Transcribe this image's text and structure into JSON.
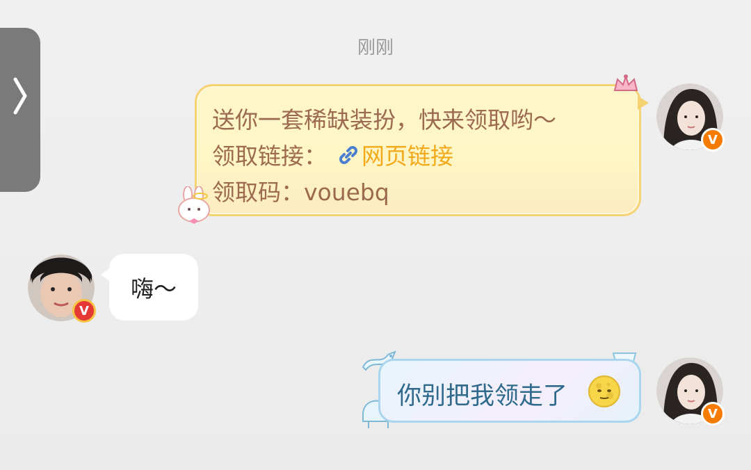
{
  "timestamp": "刚刚",
  "messages": [
    {
      "side": "right",
      "type": "card",
      "line1": "送你一套稀缺装扮，快来领取哟～",
      "line2_label": "领取链接：",
      "line2_link": "网页链接",
      "line3": "领取码：vouebq",
      "badge": "V"
    },
    {
      "side": "left",
      "type": "text",
      "text": "嗨～",
      "badge": "V"
    },
    {
      "side": "right",
      "type": "text",
      "text": "你别把我领走了",
      "emoji": "moon-face",
      "badge": "V"
    }
  ],
  "colors": {
    "card_text": "#9b6a4f",
    "link": "#f2a91a",
    "blue_text": "#2f6a8c",
    "badge_orange": "#f57c00"
  },
  "icons": [
    "chevron-right-icon",
    "link-icon",
    "moon-face-emoji",
    "bunny-sticker",
    "crown-sticker",
    "piano-sticker",
    "dragon-sticker"
  ]
}
